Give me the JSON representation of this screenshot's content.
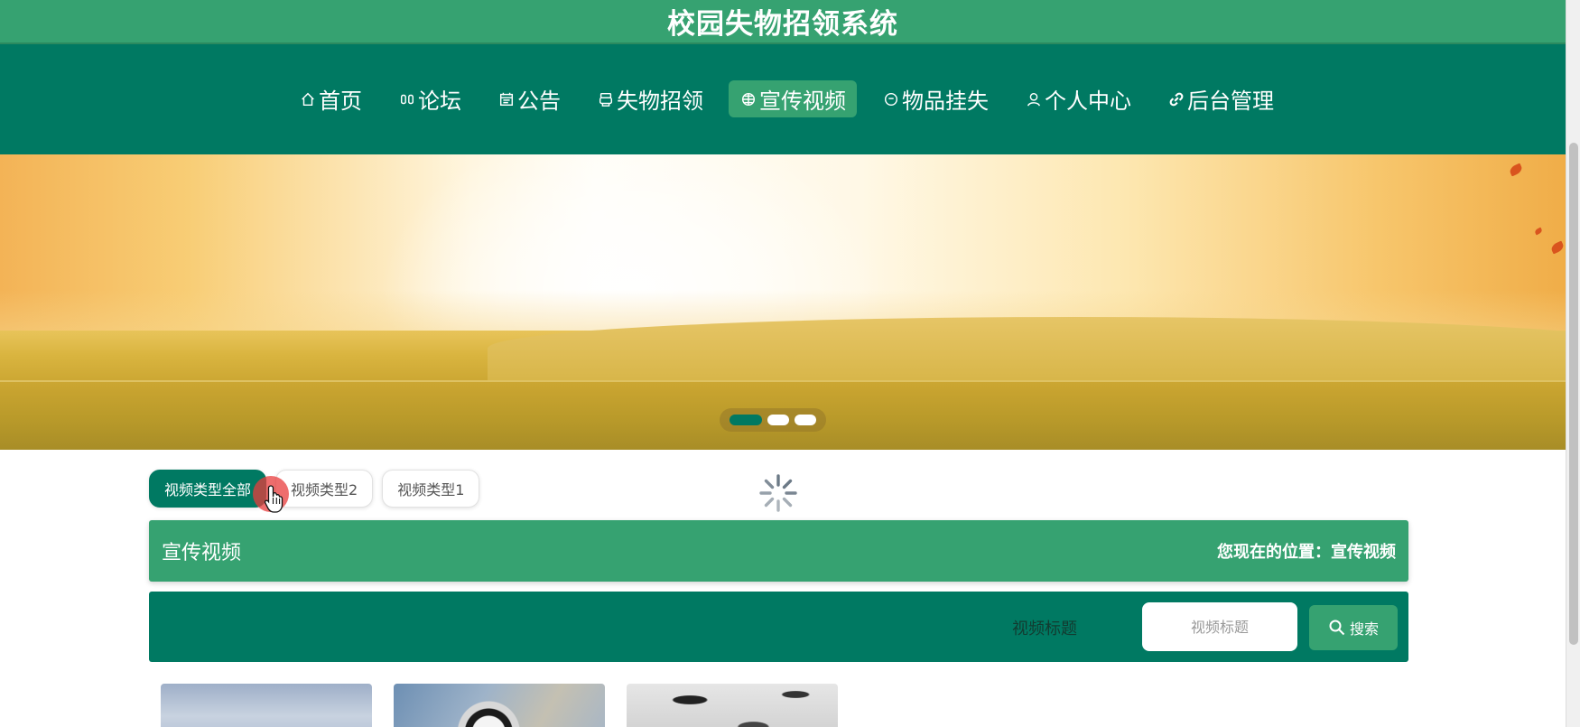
{
  "app": {
    "title": "校园失物招领系统"
  },
  "nav": {
    "items": [
      {
        "label": "首页",
        "icon": "home-icon"
      },
      {
        "label": "论坛",
        "icon": "forum-icon"
      },
      {
        "label": "公告",
        "icon": "notice-icon"
      },
      {
        "label": "失物招领",
        "icon": "lost-found-icon"
      },
      {
        "label": "宣传视频",
        "icon": "video-icon",
        "active": true
      },
      {
        "label": "物品挂失",
        "icon": "report-loss-icon"
      },
      {
        "label": "个人中心",
        "icon": "user-icon"
      },
      {
        "label": "后台管理",
        "icon": "link-icon"
      }
    ]
  },
  "banner": {
    "slides": 3,
    "active_slide": 1
  },
  "tabs": {
    "items": [
      "视频类型全部",
      "视频类型2",
      "视频类型1"
    ],
    "active_index": 0
  },
  "section": {
    "title": "宣传视频",
    "breadcrumb": "您现在的位置：宣传视频"
  },
  "search": {
    "label": "视频标题",
    "placeholder": "视频标题",
    "value": "",
    "button_label": "搜索"
  },
  "colors": {
    "title_bar": "#36a271",
    "nav": "#007962",
    "active_nav": "#36a271",
    "accent": "#36a271"
  }
}
